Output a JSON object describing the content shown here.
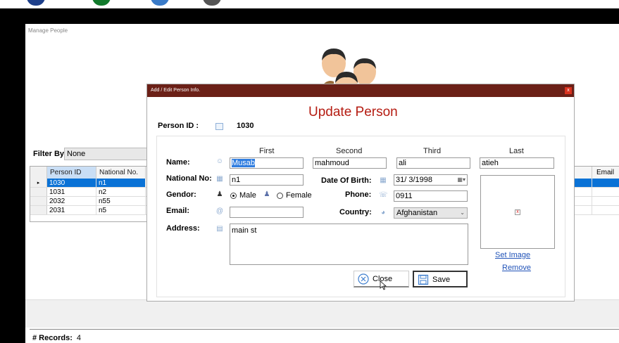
{
  "manage_people": {
    "title": "Manage People",
    "filter_label": "Filter By:",
    "filter_value": "None",
    "records_label": "# Records:",
    "records_count": "4",
    "grid": {
      "columns": [
        "Person ID",
        "National No."
      ],
      "rows": [
        {
          "id": "1030",
          "national": "n1",
          "selected": true
        },
        {
          "id": "1031",
          "national": "n2",
          "selected": false
        },
        {
          "id": "2032",
          "national": "n55",
          "selected": false
        },
        {
          "id": "2031",
          "national": "n5",
          "selected": false
        }
      ],
      "right_column": "Email"
    }
  },
  "dialog": {
    "title": "Add / Edit Person Info.",
    "close_symbol": "x",
    "heading": "Update Person",
    "person_id_label": "Person ID :",
    "person_id_value": "1030",
    "col_headers": [
      "First",
      "Second",
      "Third",
      "Last"
    ],
    "labels": {
      "name": "Name:",
      "national_no": "National No:",
      "gendor": "Gendor:",
      "email": "Email:",
      "address": "Address:",
      "dob": "Date Of Birth:",
      "phone": "Phone:",
      "country": "Country:"
    },
    "values": {
      "first": "Musab",
      "second": "mahmoud",
      "third": "ali",
      "last": "atieh",
      "national_no": "n1",
      "email": "",
      "address": "main st",
      "dob": "31/  3/1998",
      "phone": "0911",
      "country": "Afghanistan"
    },
    "gender": {
      "male": "Male",
      "female": "Female",
      "selected": "male"
    },
    "links": {
      "set_image": "Set Image",
      "remove": "Remove"
    },
    "buttons": {
      "close": "Close",
      "save": "Save"
    }
  },
  "colors": {
    "title_bar": "#6b2017",
    "heading": "#b51c12",
    "selection": "#0a72d6",
    "link": "#2153b8"
  }
}
